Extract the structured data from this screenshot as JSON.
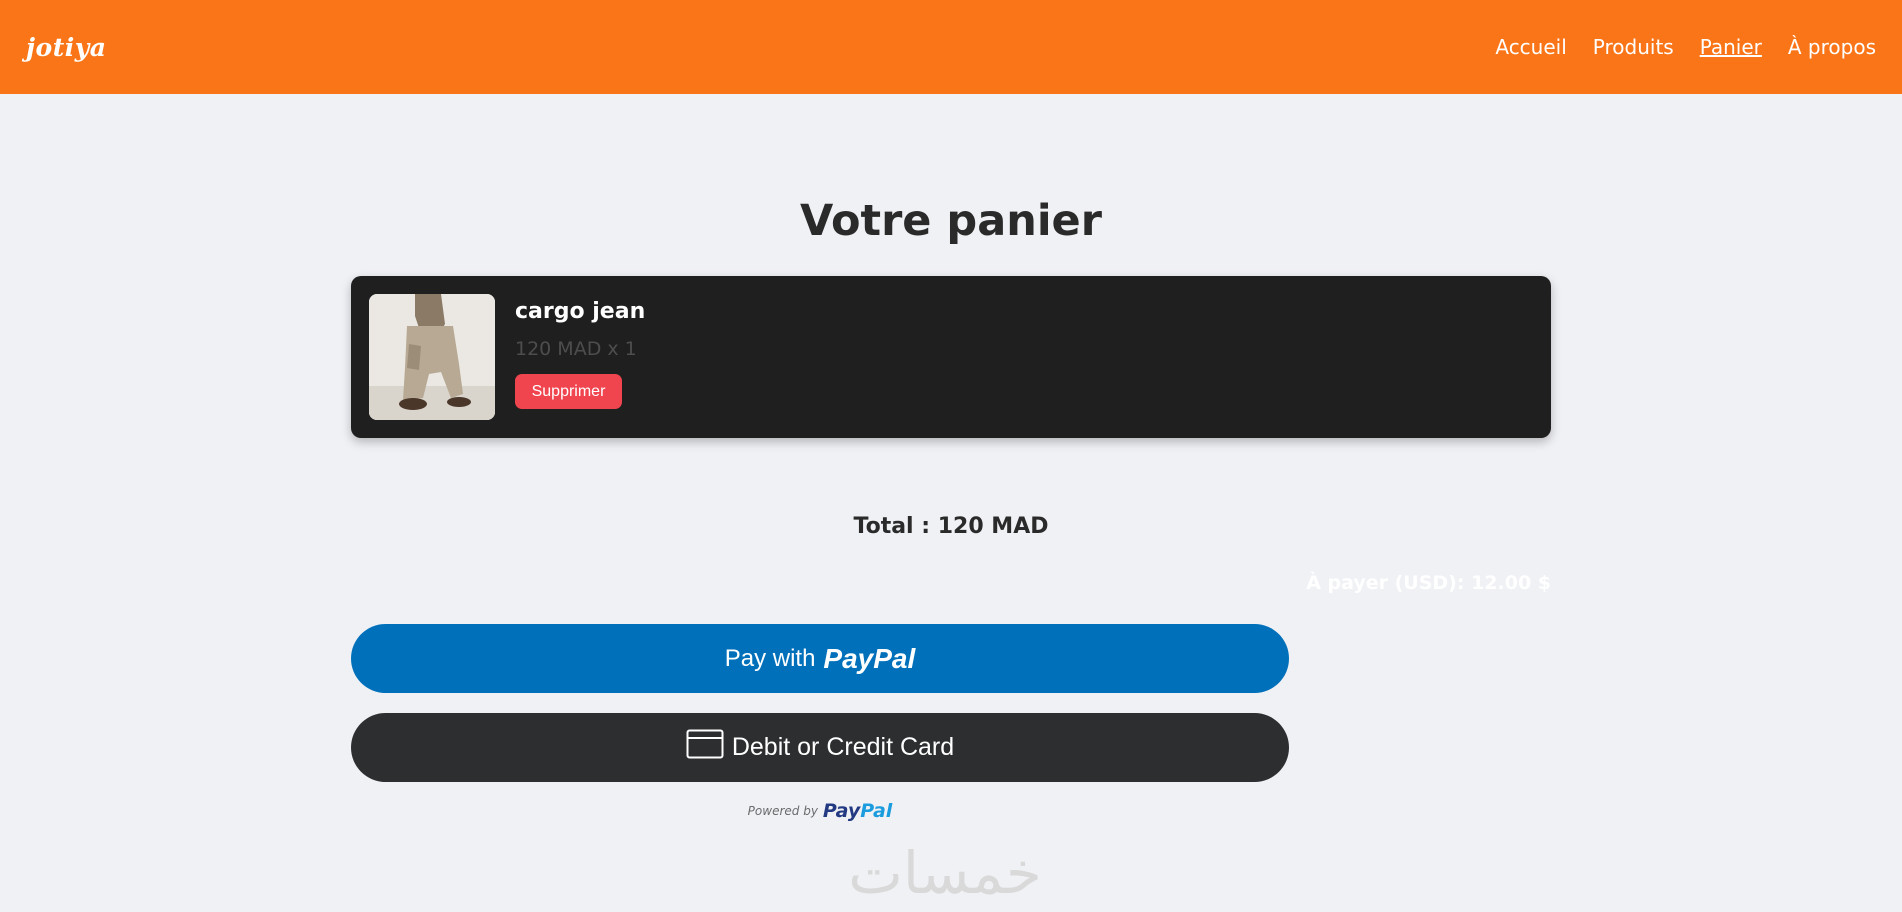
{
  "header": {
    "logo": "jotiya",
    "nav": [
      {
        "label": "Accueil"
      },
      {
        "label": "Produits"
      },
      {
        "label": "Panier"
      },
      {
        "label": "À propos"
      }
    ],
    "brand_color": "#fa7517"
  },
  "main": {
    "title": "Votre panier",
    "items": [
      {
        "name": "cargo jean",
        "price_qty": "120 MAD x 1",
        "remove_label": "Supprimer"
      }
    ],
    "total": "Total : 120 MAD",
    "usd_amount": "À payer (USD): 12.00 $"
  },
  "payment": {
    "paypal_prefix": "Pay with",
    "paypal_brand": "PayPal",
    "card_label": "Debit or Credit Card",
    "powered_by": "Powered by",
    "powered_brand_a": "Pay",
    "powered_brand_b": "Pal",
    "paypal_color": "#0170ba",
    "card_color": "#2c2e2f"
  },
  "watermark": {
    "text": "خمسات"
  }
}
